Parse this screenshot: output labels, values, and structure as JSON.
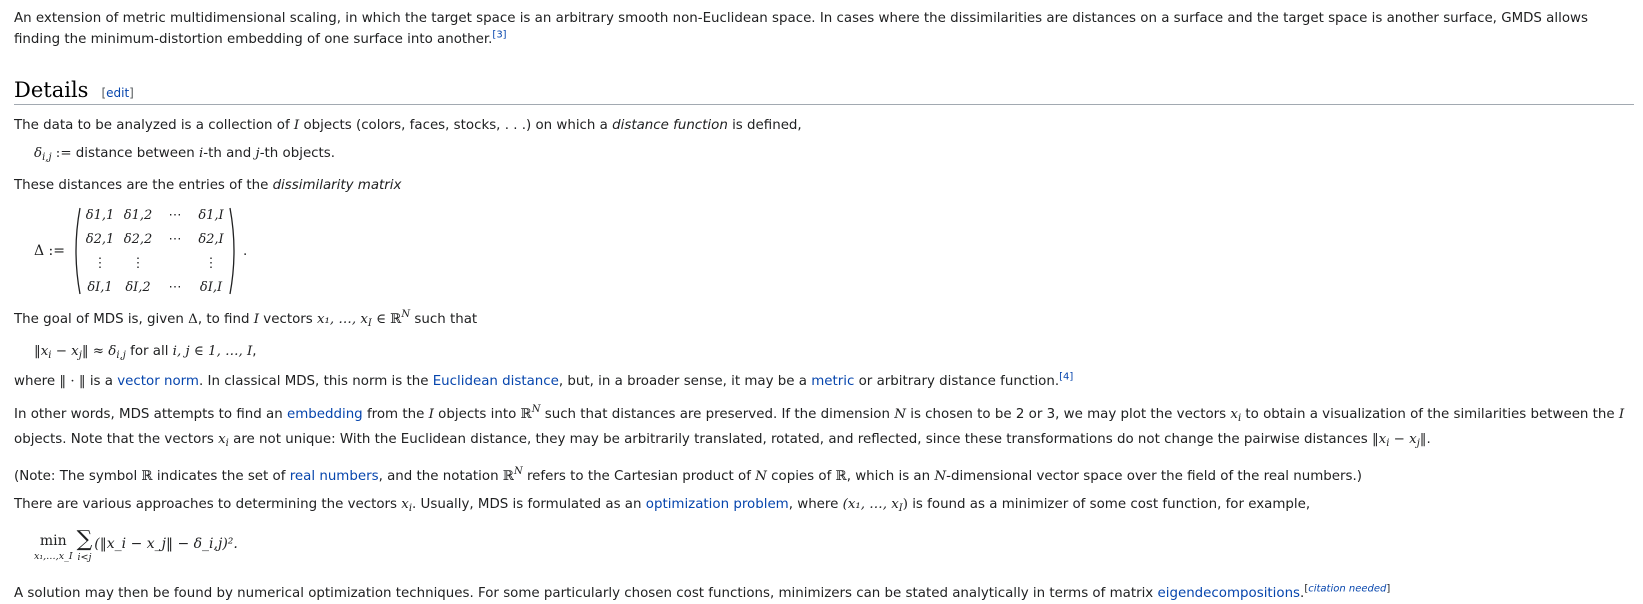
{
  "intro": {
    "text": "An extension of metric multidimensional scaling, in which the target space is an arbitrary smooth non-Euclidean space. In cases where the dissimilarities are distances on a surface and the target space is another surface, GMDS allows finding the minimum-distortion embedding of one surface into another.",
    "cite": "[3]"
  },
  "section": {
    "title": "Details",
    "edit_open": "[",
    "edit_label": "edit",
    "edit_close": "]"
  },
  "p1": {
    "a": "The data to be analyzed is a collection of ",
    "I": "I",
    "b": " objects (colors, faces, stocks, . . .) on which a ",
    "em": "distance function",
    "c": " is defined,"
  },
  "def": {
    "delta": "δ",
    "sub": "i,j",
    "assign": " := ",
    "a": "distance between ",
    "i": "i",
    "b": "-th and ",
    "j": "j",
    "c": "-th objects."
  },
  "p2": {
    "a": "These distances are the entries of the ",
    "em": "dissimilarity matrix"
  },
  "matrix": {
    "lhs": "Δ :=",
    "cells": [
      [
        "δ1,1",
        "δ1,2",
        "⋯",
        "δ1,I"
      ],
      [
        "δ2,1",
        "δ2,2",
        "⋯",
        "δ2,I"
      ],
      [
        "⋮",
        "⋮",
        "",
        "⋮"
      ],
      [
        "δI,1",
        "δI,2",
        "⋯",
        "δI,I"
      ]
    ],
    "end": "."
  },
  "p3": {
    "a": "The goal of MDS is, given ",
    "Delta": "Δ",
    "b": ", to find ",
    "I": "I",
    "c": " vectors ",
    "vec": "x₁, …, x",
    "vecI": "I",
    "in": " ∈ ℝ",
    "N": "N",
    "d": " such that"
  },
  "eq1": {
    "lhs": "‖x",
    "i": "i",
    "minus": " − x",
    "j": "j",
    "approx": "‖ ≈ δ",
    "sub": "i,j",
    "for": " for all ",
    "range": "i, j ∈ 1, …, I",
    "end": ","
  },
  "p4": {
    "a": "where ",
    "norm": "‖ · ‖",
    "b": " is a ",
    "l1": "vector norm",
    "c": ". In classical MDS, this norm is the ",
    "l2": "Euclidean distance",
    "d": ", but, in a broader sense, it may be a ",
    "l3": "metric",
    "e": " or arbitrary distance function.",
    "cite": "[4]"
  },
  "p5": {
    "a": "In other words, MDS attempts to find an ",
    "l1": "embedding",
    "b": " from the ",
    "I": "I",
    "c": " objects into ",
    "R": "ℝ",
    "N": "N",
    "d": " such that distances are preserved. If the dimension ",
    "N2": "N",
    "e": " is chosen to be 2 or 3, we may plot the vectors ",
    "x": "x",
    "xi": "i",
    "f": " to obtain a visualization of the similarities between the ",
    "I2": "I",
    "g": " objects. Note that the vectors ",
    "x2": "x",
    "xi2": "i",
    "h": " are not unique: With the Euclidean distance, they may be arbitrarily translated, rotated, and reflected, since these transformations do not change the pairwise distances ",
    "dist": "‖x",
    "di": "i",
    "dm": " − x",
    "dj": "j",
    "dend": "‖",
    "end": "."
  },
  "p6": {
    "a": "(Note: The symbol ",
    "R": "ℝ",
    "b": " indicates the set of ",
    "l1": "real numbers",
    "c": ", and the notation ",
    "R2": "ℝ",
    "N": "N",
    "d": " refers to the Cartesian product of ",
    "N2": "N",
    "e": " copies of ",
    "R3": "ℝ",
    "f": ", which is an ",
    "N3": "N",
    "g": "-dimensional vector space over the field of the real numbers.)"
  },
  "p7": {
    "a": "There are various approaches to determining the vectors ",
    "x": "x",
    "xi": "i",
    "b": ". Usually, MDS is formulated as an ",
    "l1": "optimization problem",
    "c": ", where ",
    "tuple": "(x₁, …, x",
    "tI": "I",
    "tend": ")",
    "d": " is found as a minimizer of some cost function, for example,"
  },
  "minimize": {
    "min": "min",
    "under_min": "x₁,…,x_I",
    "sigma": "∑",
    "under_sum": "i<j",
    "expr": "(‖x_i − x_j‖ − δ_i,j)²."
  },
  "p8": {
    "a": "A solution may then be found by numerical optimization techniques. For some particularly chosen cost functions, minimizers can be stated analytically in terms of matrix ",
    "l1": "eigendecompositions",
    "b": ".",
    "cite_open": "[",
    "cite_label": "citation needed",
    "cite_close": "]"
  }
}
